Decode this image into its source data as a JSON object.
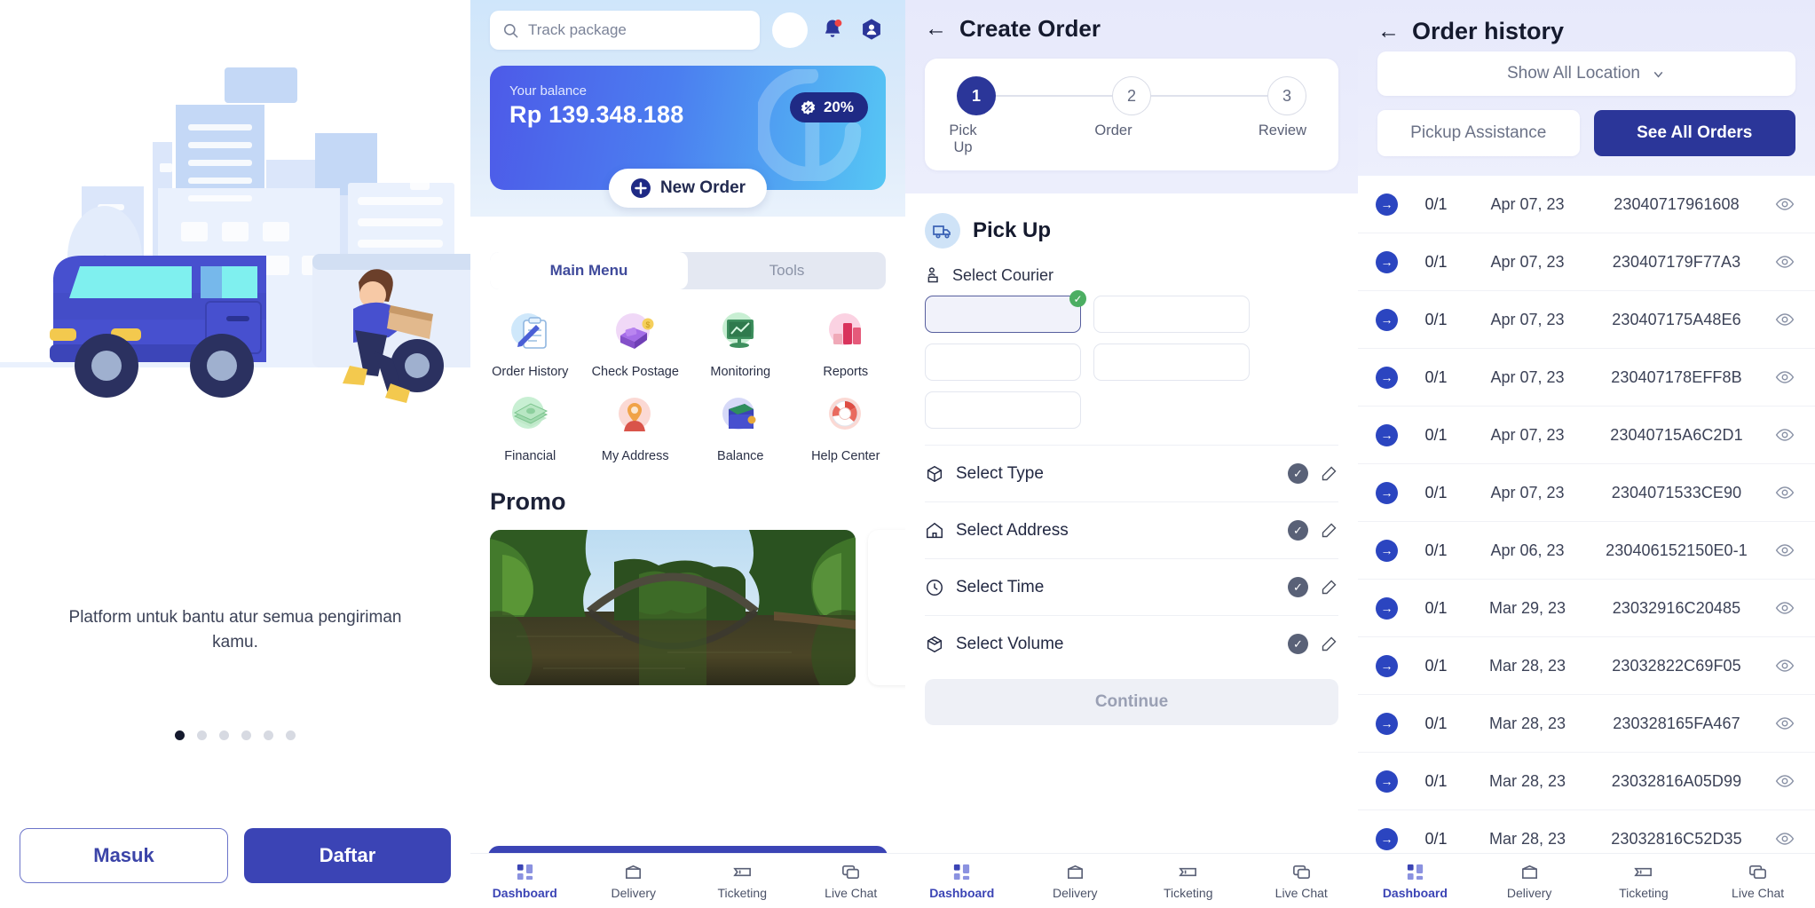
{
  "onboarding": {
    "caption": "Platform untuk bantu atur semua pengiriman kamu.",
    "login_label": "Masuk",
    "register_label": "Daftar",
    "dots_total": 6,
    "dots_active_index": 0
  },
  "dashboard": {
    "search_placeholder": "Track package",
    "balance": {
      "label": "Your balance",
      "amount": "Rp 139.348.188",
      "discount": "20%",
      "new_order_label": "New Order"
    },
    "tabs": [
      {
        "label": "Main Menu",
        "active": true
      },
      {
        "label": "Tools",
        "active": false
      }
    ],
    "menu": [
      {
        "label": "Order History",
        "icon": "clipboard-pen-icon",
        "bg": "#cfe8fb"
      },
      {
        "label": "Check Postage",
        "icon": "truck-coin-icon",
        "bg": "#f0d8f7"
      },
      {
        "label": "Monitoring",
        "icon": "monitor-chart-icon",
        "bg": "#c8efd3"
      },
      {
        "label": "Reports",
        "icon": "bar-chart-icon",
        "bg": "#fbd2e2"
      },
      {
        "label": "Financial",
        "icon": "money-stack-icon",
        "bg": "#c8efd3"
      },
      {
        "label": "My Address",
        "icon": "person-pin-icon",
        "bg": "#fbd9d4"
      },
      {
        "label": "Balance",
        "icon": "wallet-icon",
        "bg": "#d6d9f8"
      },
      {
        "label": "Help Center",
        "icon": "lifebuoy-icon",
        "bg": "#fbd9d4"
      }
    ],
    "promo_title": "Promo",
    "nav": [
      {
        "label": "Dashboard",
        "icon": "grid-icon",
        "active": true
      },
      {
        "label": "Delivery",
        "icon": "box-icon",
        "active": false
      },
      {
        "label": "Ticketing",
        "icon": "ticket-icon",
        "active": false
      },
      {
        "label": "Live Chat",
        "icon": "chat-icon",
        "active": false
      }
    ]
  },
  "create_order": {
    "title": "Create Order",
    "back_icon": "back-arrow-icon",
    "steps": [
      {
        "number": "1",
        "label": "Pick Up",
        "active": true
      },
      {
        "number": "2",
        "label": "Order",
        "active": false
      },
      {
        "number": "3",
        "label": "Review",
        "active": false
      }
    ],
    "section_title": "Pick Up",
    "section_icon": "truck-icon",
    "select_courier_label": "Select Courier",
    "courier_boxes": [
      {
        "selected": true
      },
      {
        "selected": false
      },
      {
        "selected": false
      },
      {
        "selected": false
      },
      {
        "selected": false
      }
    ],
    "rows": [
      {
        "label": "Select Type",
        "icon": "box-3d-icon"
      },
      {
        "label": "Select Address",
        "icon": "home-icon"
      },
      {
        "label": "Select Time",
        "icon": "clock-icon"
      },
      {
        "label": "Select Volume",
        "icon": "cube-open-icon"
      }
    ],
    "continue_label": "Continue",
    "nav": [
      {
        "label": "Dashboard",
        "icon": "grid-icon",
        "active": true
      },
      {
        "label": "Delivery",
        "icon": "box-icon",
        "active": false
      },
      {
        "label": "Ticketing",
        "icon": "ticket-icon",
        "active": false
      },
      {
        "label": "Live Chat",
        "icon": "chat-icon",
        "active": false
      }
    ]
  },
  "order_history": {
    "title": "Order history",
    "back_icon": "back-arrow-icon",
    "location_filter": "Show All Location",
    "pickup_assistance_label": "Pickup Assistance",
    "see_all_orders_label": "See All Orders",
    "orders": [
      {
        "count": "0/1",
        "date": "Apr 07, 23",
        "id": "23040717961608"
      },
      {
        "count": "0/1",
        "date": "Apr 07, 23",
        "id": "230407179F77A3"
      },
      {
        "count": "0/1",
        "date": "Apr 07, 23",
        "id": "230407175A48E6"
      },
      {
        "count": "0/1",
        "date": "Apr 07, 23",
        "id": "230407178EFF8B"
      },
      {
        "count": "0/1",
        "date": "Apr 07, 23",
        "id": "23040715A6C2D1"
      },
      {
        "count": "0/1",
        "date": "Apr 07, 23",
        "id": "2304071533CE90"
      },
      {
        "count": "0/1",
        "date": "Apr 06, 23",
        "id": "230406152150E0-1"
      },
      {
        "count": "0/1",
        "date": "Mar 29, 23",
        "id": "23032916C20485"
      },
      {
        "count": "0/1",
        "date": "Mar 28, 23",
        "id": "23032822C69F05"
      },
      {
        "count": "0/1",
        "date": "Mar 28, 23",
        "id": "230328165FA467"
      },
      {
        "count": "0/1",
        "date": "Mar 28, 23",
        "id": "23032816A05D99"
      },
      {
        "count": "0/1",
        "date": "Mar 28, 23",
        "id": "23032816C52D35"
      }
    ],
    "nav": [
      {
        "label": "Dashboard",
        "icon": "grid-icon",
        "active": true
      },
      {
        "label": "Delivery",
        "icon": "box-icon",
        "active": false
      },
      {
        "label": "Ticketing",
        "icon": "ticket-icon",
        "active": false
      },
      {
        "label": "Live Chat",
        "icon": "chat-icon",
        "active": false
      }
    ]
  },
  "colors": {
    "primary": "#3b44b5",
    "accent_blue": "#2b3699",
    "success_green": "#4cae62",
    "notification_red": "#ef4444"
  }
}
